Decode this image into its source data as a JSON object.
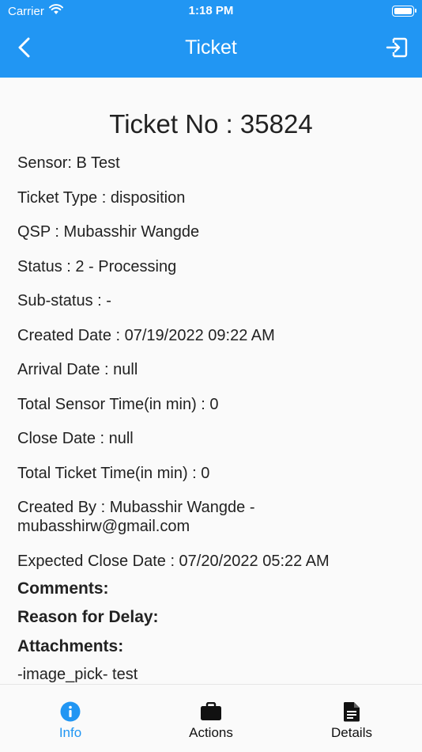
{
  "status_bar": {
    "carrier": "Carrier",
    "time": "1:18 PM"
  },
  "header": {
    "title": "Ticket"
  },
  "ticket": {
    "heading": "Ticket No : 35824",
    "lines": [
      "Sensor: B Test",
      "Ticket Type : disposition",
      "QSP : Mubasshir Wangde",
      "Status : 2 - Processing",
      "Sub-status : -",
      "Created Date : 07/19/2022 09:22 AM",
      "Arrival Date : null",
      "Total Sensor Time(in min) : 0",
      "Close Date : null",
      "Total Ticket Time(in min) : 0",
      "Created By : Mubasshir Wangde - mubasshirw@gmail.com",
      "Expected Close Date : 07/20/2022 05:22 AM"
    ],
    "comments_label": "Comments:",
    "reason_label": "Reason for Delay:",
    "attachments_label": "Attachments:",
    "attachments": [
      "-image_pick- test"
    ]
  },
  "bottom_nav": {
    "tabs": [
      {
        "label": "Info",
        "icon": "info-icon",
        "active": true
      },
      {
        "label": "Actions",
        "icon": "briefcase-icon",
        "active": false
      },
      {
        "label": "Details",
        "icon": "document-icon",
        "active": false
      }
    ]
  },
  "colors": {
    "primary": "#2196f3",
    "background": "#fafafa",
    "text": "#222222"
  }
}
